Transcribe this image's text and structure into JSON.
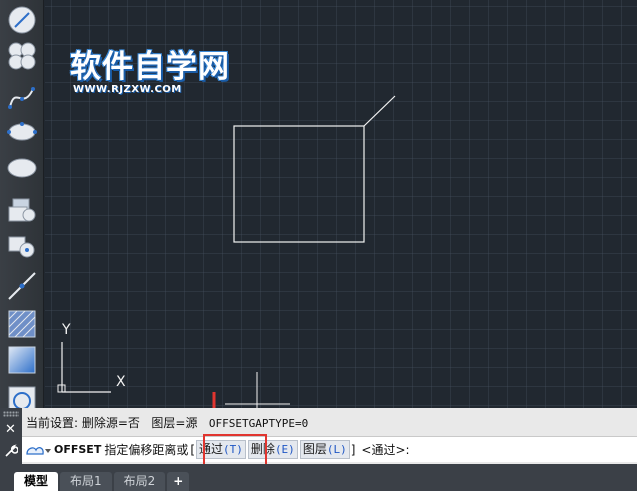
{
  "watermark": {
    "title": "软件自学网",
    "url": "WWW.RJZXW.COM"
  },
  "canvas": {
    "ucs_y_label": "Y",
    "ucs_x_label": "X"
  },
  "command": {
    "history": {
      "prefix": "当前设置:",
      "delete_source": "删除源=否",
      "layer": "图层=源",
      "gaptype": "OFFSETGAPTYPE=0"
    },
    "current": {
      "name": "OFFSET",
      "prompt": "指定偏移距离或",
      "open_bracket": "[",
      "options": [
        {
          "label": "通过",
          "key": "(T)"
        },
        {
          "label": "删除",
          "key": "(E)"
        },
        {
          "label": "图层",
          "key": "(L)"
        }
      ],
      "close_bracket": "]",
      "default": "<通过>:"
    }
  },
  "tabs": [
    {
      "label": "模型",
      "active": true
    },
    {
      "label": "布局1",
      "active": false
    },
    {
      "label": "布局2",
      "active": false
    },
    {
      "label": "+",
      "active": false
    }
  ],
  "colors": {
    "canvas_bg": "#212830",
    "highlight": "#e1352f",
    "watermark_blue": "#2f7fd1"
  },
  "icons": {
    "toolbar": [
      "line-draw-icon",
      "cloud-icon",
      "spline-icon",
      "ellipse-icon",
      "ellipse-arc-icon",
      "block-insert-icon",
      "make-block-icon",
      "construction-line-icon",
      "hatch-icon",
      "gradient-icon",
      "region-icon"
    ],
    "cmd_close": "close-icon",
    "cmd_settings": "wrench-icon"
  }
}
